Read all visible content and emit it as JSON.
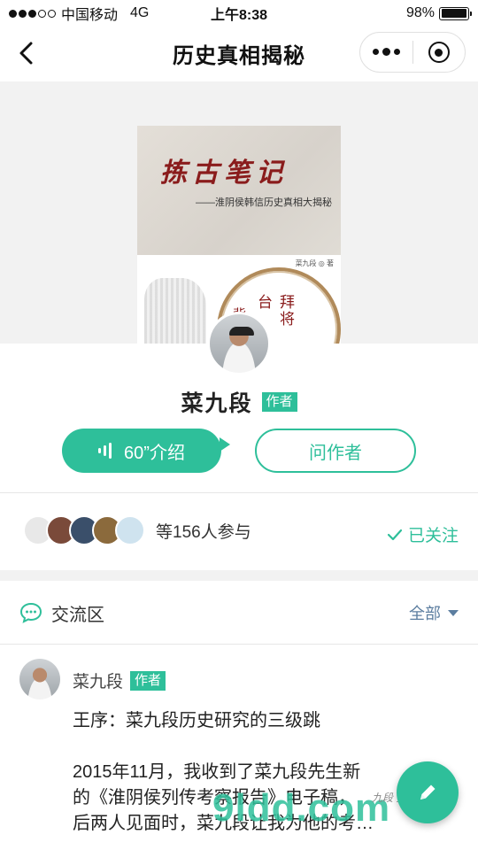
{
  "status_bar": {
    "carrier": "中国移动",
    "network": "4G",
    "time": "上午8:38",
    "battery": "98%",
    "battery_level": 0.98,
    "signal_bars": 3,
    "signal_total": 5
  },
  "nav": {
    "title": "历史真相揭秘"
  },
  "cover": {
    "title": "拣古笔记",
    "subtitle": "——淮阴侯韩信历史真相大揭秘",
    "author_line": "菜九段 ◎ 著",
    "calligraphy_1": "拜将台",
    "calligraphy_2": "背水"
  },
  "author": {
    "name": "菜九段",
    "tag": "作者"
  },
  "actions": {
    "intro_label": "60”介绍",
    "ask_label": "问作者"
  },
  "participants": {
    "text": "等156人参与",
    "follow_label": "已关注",
    "avatar_colors": [
      "#e8e8e8",
      "#7a4a3a",
      "#3a4f6a",
      "#8b6a3c",
      "#cfe3ef"
    ]
  },
  "discussion": {
    "title": "交流区",
    "filter_label": "全部"
  },
  "post": {
    "author": "菜九段",
    "tag": "作者",
    "lines": [
      "王序：菜九段历史研究的三级跳",
      "",
      "2015年11月，我收到了菜九段先生新",
      "的《淮阴侯列传考察报告》电子稿，",
      "后两人见面时，菜九段让我为他的考…"
    ]
  },
  "watermark": {
    "main": "9ldd.com",
    "small": "九段 资 志"
  },
  "colors": {
    "accent": "#2ebf9a",
    "link": "#5c7ea0"
  }
}
